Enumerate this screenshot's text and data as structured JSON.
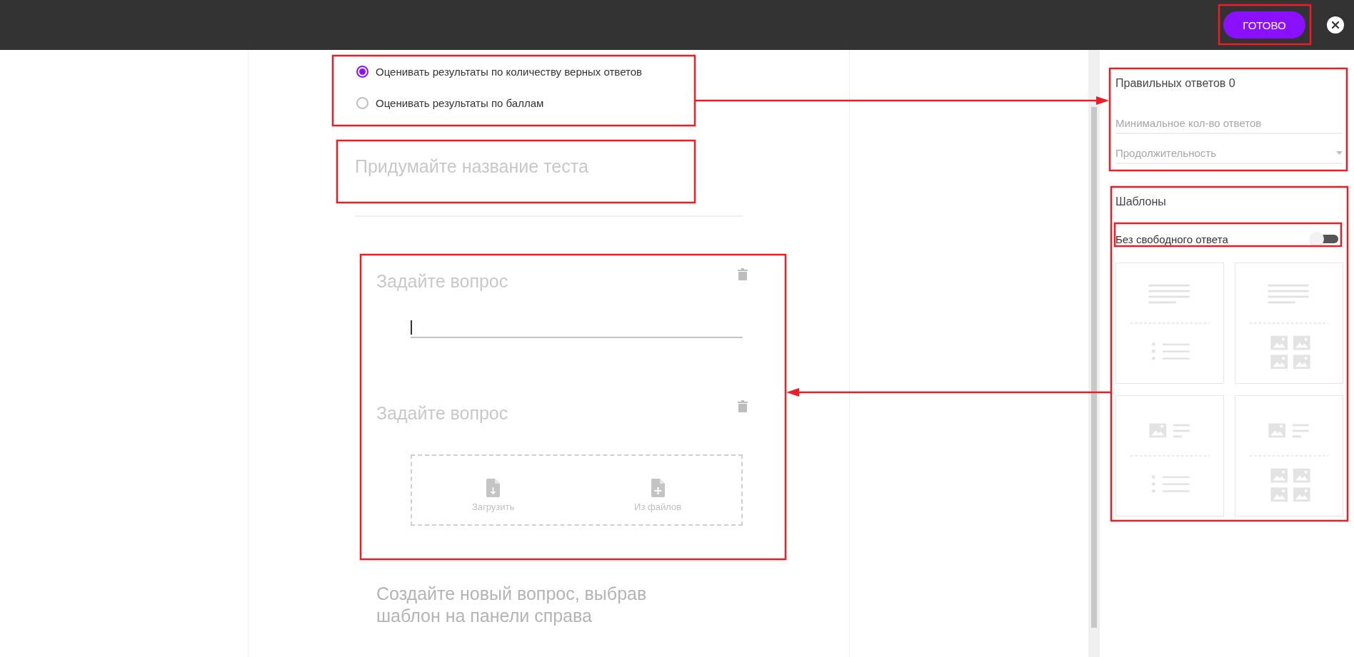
{
  "top_bar": {
    "done_button": "ГОТОВО"
  },
  "grading": {
    "options": [
      {
        "label": "Оценивать результаты по количеству верных ответов",
        "selected": true
      },
      {
        "label": "Оценивать результаты по баллам",
        "selected": false
      }
    ]
  },
  "test_title": {
    "placeholder": "Придумайте название теста"
  },
  "questions": [
    {
      "kind": "text",
      "placeholder": "Задайте вопрос"
    },
    {
      "kind": "media",
      "placeholder": "Задайте вопрос",
      "actions": [
        "Загрузить",
        "Из файлов"
      ]
    }
  ],
  "hint": "Создайте новый вопрос, выбрав шаблон на панели справа",
  "settings": {
    "title": "Правильных ответов 0",
    "fields": [
      {
        "kind": "input",
        "placeholder": "Минимальное кол-во ответов"
      },
      {
        "kind": "select",
        "placeholder": "Продолжительность"
      }
    ]
  },
  "templates": {
    "title": "Шаблоны",
    "toggle": {
      "label": "Без свободного ответа",
      "on": false
    },
    "cards": [
      {
        "kind": "text-list"
      },
      {
        "kind": "text-images"
      },
      {
        "kind": "image-list"
      },
      {
        "kind": "image-images"
      }
    ]
  }
}
